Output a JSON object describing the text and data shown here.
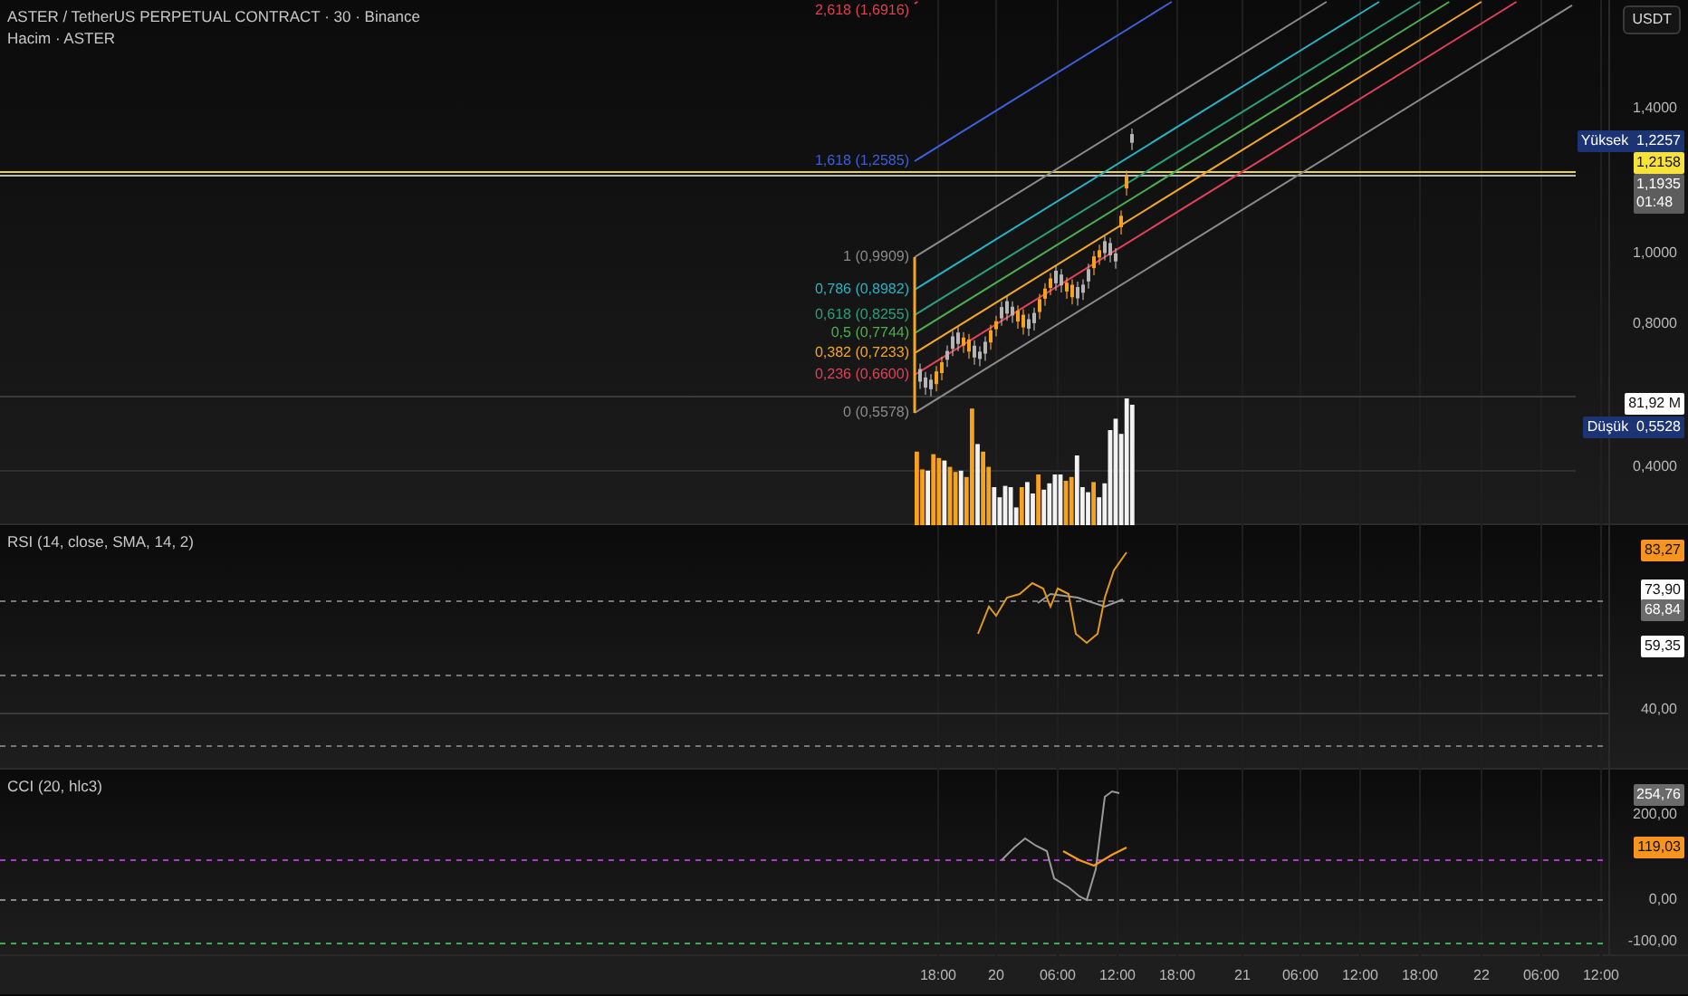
{
  "header": {
    "title": "ASTER / TetherUS PERPETUAL CONTRACT · 30 · Binance",
    "volume_legend": "Hacim · ASTER"
  },
  "currency_button": "USDT",
  "fib_levels": [
    {
      "label": "2,618 (1,6916)",
      "color": "#e0404e"
    },
    {
      "label": "1,618 (1,2585)",
      "color": "#3d5fd8"
    },
    {
      "label": "1 (0,9909)",
      "color": "#8a8a8a"
    },
    {
      "label": "0,786 (0,8982)",
      "color": "#26b3c4"
    },
    {
      "label": "0,618 (0,8255)",
      "color": "#2a9f7c"
    },
    {
      "label": "0,5 (0,7744)",
      "color": "#4cae50"
    },
    {
      "label": "0,382 (0,7233)",
      "color": "#f5a524"
    },
    {
      "label": "0,236 (0,6600)",
      "color": "#e0405a"
    },
    {
      "label": "0 (0,5578)",
      "color": "#8a8a8a"
    }
  ],
  "price_axis": {
    "ticks": [
      "1,4000",
      "1,0000",
      "0,8000",
      "0,4000"
    ],
    "tags": [
      {
        "label": "Yüksek",
        "value": "1,2257",
        "color": "#1c3473"
      },
      {
        "value": "1,2158",
        "color": "#f7e23a"
      },
      {
        "value": "1,1935",
        "time": "01:48",
        "color": "#5d5d5d"
      },
      {
        "value": "81,92 M",
        "color": "#ffffff"
      },
      {
        "label": "Düşük",
        "value": "0,5528",
        "color": "#1c3473"
      }
    ]
  },
  "rsi": {
    "legend": "RSI (14, close, SMA, 14, 2)",
    "ticks": [
      "40,00"
    ],
    "tags": [
      {
        "value": "83,27",
        "color": "#f7941d"
      },
      {
        "value": "73,90",
        "color": "#ffffff"
      },
      {
        "value": "68,84",
        "color": "#6b6b6b"
      },
      {
        "value": "59,35",
        "color": "#ffffff"
      }
    ]
  },
  "cci": {
    "legend": "CCI (20, hlc3)",
    "ticks": [
      "200,00",
      "0,00",
      "-100,00"
    ],
    "tags": [
      {
        "value": "254,76",
        "color": "#6b6b6b"
      },
      {
        "value": "119,03",
        "color": "#f7941d"
      }
    ]
  },
  "time_axis": [
    "18:00",
    "20",
    "06:00",
    "12:00",
    "18:00",
    "21",
    "06:00",
    "12:00",
    "18:00",
    "22",
    "06:00",
    "12:00"
  ]
}
